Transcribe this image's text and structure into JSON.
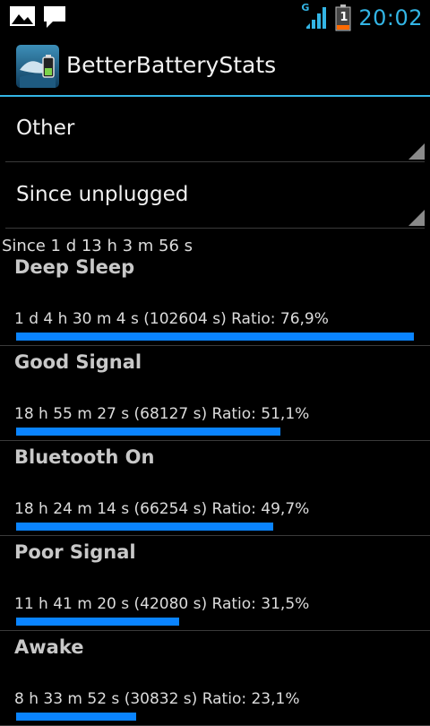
{
  "status_bar": {
    "clock": "20:02",
    "network_type": "G",
    "battery_level_text": "1",
    "icons": [
      "gallery-notification-icon",
      "message-notification-icon",
      "signal-icon",
      "battery-icon"
    ]
  },
  "action_bar": {
    "title": "BetterBatteryStats",
    "icon": "better-battery-stats-app-icon"
  },
  "spinners": {
    "stat_type": "Other",
    "stat_range": "Since unplugged"
  },
  "since_text": "Since 1 d 13 h 3 m 56 s",
  "colors": {
    "accent": "#33b5e5",
    "bar": "#0a84ff"
  },
  "stats": [
    {
      "name": "Deep Sleep",
      "detail": "1 d 4 h 30 m 4 s  (102604 s) Ratio: 76,9%",
      "ratio": 0.769
    },
    {
      "name": "Good Signal",
      "detail": "18 h 55 m 27 s  (68127 s) Ratio: 51,1%",
      "ratio": 0.511
    },
    {
      "name": "Bluetooth On",
      "detail": "18 h 24 m 14 s  (66254 s) Ratio: 49,7%",
      "ratio": 0.497
    },
    {
      "name": "Poor Signal",
      "detail": "11 h 41 m 20 s  (42080 s) Ratio: 31,5%",
      "ratio": 0.315
    },
    {
      "name": "Awake",
      "detail": "8 h 33 m 52 s  (30832 s) Ratio: 23,1%",
      "ratio": 0.231
    }
  ]
}
